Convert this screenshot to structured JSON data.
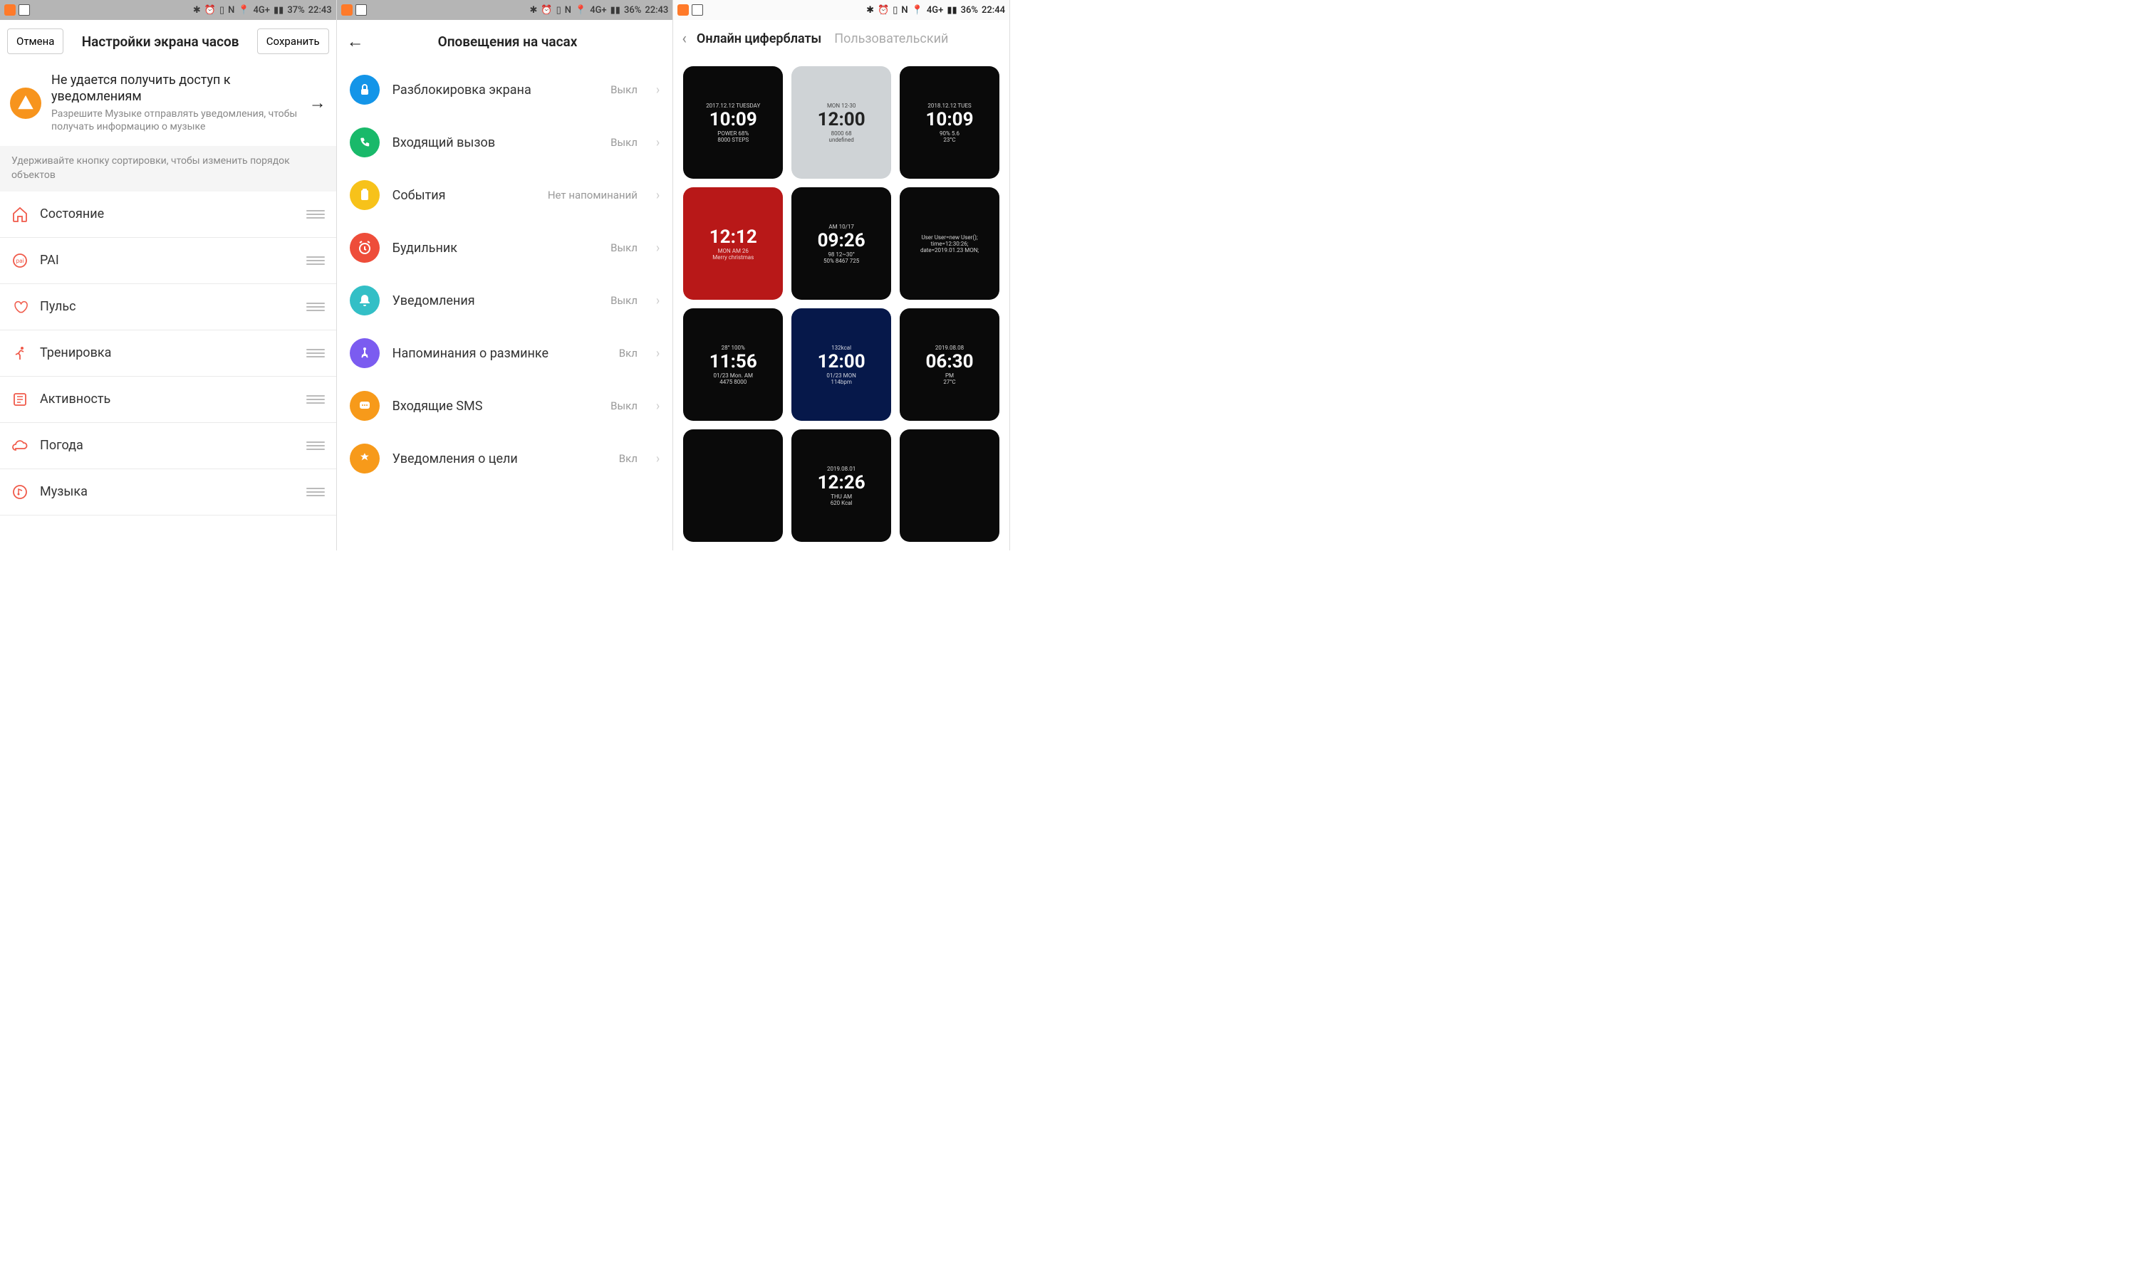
{
  "status1": {
    "battery": "37%",
    "time": "22:43",
    "net": "4G+"
  },
  "status2": {
    "battery": "36%",
    "time": "22:43",
    "net": "4G+"
  },
  "status3": {
    "battery": "36%",
    "time": "22:44",
    "net": "4G+"
  },
  "screen1": {
    "cancel": "Отмена",
    "title": "Настройки экрана часов",
    "save": "Сохранить",
    "notice_title": "Не удается получить доступ к уведомлениям",
    "notice_sub": "Разрешите Музыке отправлять уведомления, чтобы получать информацию о музыке",
    "hint": "Удерживайте кнопку сортировки, чтобы изменить порядок объектов",
    "items": [
      {
        "label": "Состояние",
        "icon": "home",
        "color": "#f05a4a"
      },
      {
        "label": "PAI",
        "icon": "pai",
        "color": "#f05a4a"
      },
      {
        "label": "Пульс",
        "icon": "heart",
        "color": "#f05a4a"
      },
      {
        "label": "Тренировка",
        "icon": "run",
        "color": "#f05a4a"
      },
      {
        "label": "Активность",
        "icon": "activity",
        "color": "#f05a4a"
      },
      {
        "label": "Погода",
        "icon": "cloud",
        "color": "#f05a4a"
      },
      {
        "label": "Музыка",
        "icon": "music",
        "color": "#f05a4a"
      }
    ]
  },
  "screen2": {
    "title": "Оповещения на часах",
    "items": [
      {
        "label": "Разблокировка экрана",
        "status": "Выкл",
        "color": "#1495e8",
        "icon": "lock"
      },
      {
        "label": "Входящий вызов",
        "status": "Выкл",
        "color": "#19b96a",
        "icon": "phone"
      },
      {
        "label": "События",
        "status": "Нет напоминаний",
        "color": "#f7c21a",
        "icon": "clipboard"
      },
      {
        "label": "Будильник",
        "status": "Выкл",
        "color": "#ee4d3a",
        "icon": "alarm"
      },
      {
        "label": "Уведомления",
        "status": "Выкл",
        "color": "#33bfc6",
        "icon": "bell"
      },
      {
        "label": "Напоминания о разминке",
        "status": "Вкл",
        "color": "#7b5cf0",
        "icon": "stretch"
      },
      {
        "label": "Входящие SMS",
        "status": "Выкл",
        "color": "#f79a1a",
        "icon": "sms"
      },
      {
        "label": "Уведомления о цели",
        "status": "Вкл",
        "color": "#f79a1a",
        "icon": "goal"
      }
    ]
  },
  "screen3": {
    "tab_active": "Онлайн циферблаты",
    "tab_inactive": "Пользовательский",
    "faces": [
      {
        "bg": "black",
        "time": "10:09",
        "top": "2017.12.12 TUESDAY",
        "bottom": "POWER 68%",
        "extra": "8000 STEPS"
      },
      {
        "bg": "gray",
        "time": "12:00",
        "top": "MON 12-30",
        "bottom": "8000  68"
      },
      {
        "bg": "black",
        "time": "10:09",
        "top": "2018.12.12 TUES",
        "bottom": "90%  5.6",
        "extra": "23°C"
      },
      {
        "bg": "red",
        "time": "12:12",
        "top": "",
        "bottom": "MON AM 26",
        "extra": "Merry christmas"
      },
      {
        "bg": "black",
        "time": "09:26",
        "top": "AM 10/17",
        "bottom": "98  12~30°",
        "extra": "50% 8467 725"
      },
      {
        "bg": "black",
        "time": "",
        "top": "User User=new User();",
        "bottom": "time=12:30:26;",
        "extra": "date=2019.01.23 MON;"
      },
      {
        "bg": "black",
        "time": "11:56",
        "top": "28°  100%",
        "bottom": "01/23 Mon. AM",
        "extra": "4475 8000"
      },
      {
        "bg": "blue",
        "time": "12:00",
        "top": "132kcal",
        "bottom": "01/23 MON",
        "extra": "114bpm"
      },
      {
        "bg": "black",
        "time": "06:30",
        "top": "2019.08.08",
        "bottom": "PM",
        "extra": "27°C"
      },
      {
        "bg": "black",
        "time": "",
        "top": "",
        "bottom": "",
        "extra": ""
      },
      {
        "bg": "black",
        "time": "12:26",
        "top": "2019.08.01",
        "bottom": "THU AM",
        "extra": "620 Kcal"
      },
      {
        "bg": "black",
        "time": "",
        "top": "",
        "bottom": "",
        "extra": ""
      }
    ]
  }
}
